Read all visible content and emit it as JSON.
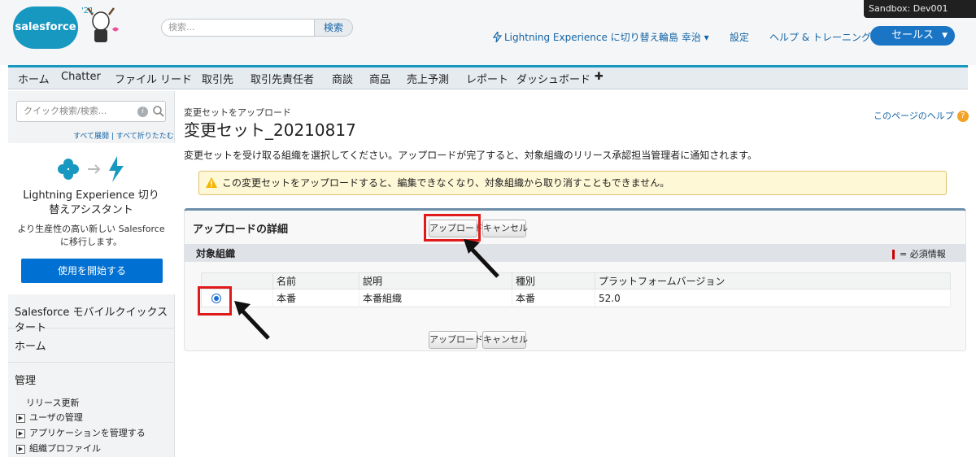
{
  "header": {
    "logo_text": "salesforce",
    "year_badge": "'21",
    "search_placeholder": "検索...",
    "search_button": "検索",
    "sandbox_label": "Sandbox:  Dev001",
    "lightning_switch": "Lightning Experience に切り替え",
    "user_name": "輪島 幸治 ▾",
    "setup": "設定",
    "help_training": "ヘルプ & トレーニング",
    "app_menu": "セールス",
    "app_menu_caret": "▼"
  },
  "tabs": [
    "ホーム",
    "Chatter",
    "ファイル",
    "リード",
    "取引先",
    "取引先責任者",
    "商談",
    "商品",
    "売上予測",
    "レポート",
    "ダッシュボード",
    "✚"
  ],
  "sidebar": {
    "quick_find_placeholder": "クイック検索/検索...",
    "quick_find_info": "i",
    "expand_links": "すべて展開 | すべて折りたたむ",
    "assistant_title": "Lightning Experience 切り替えアシスタント",
    "assistant_desc": "より生産性の高い新しい Salesforce に移行します。",
    "start_button": "使用を開始する",
    "mobile_quickstart": "Salesforce モバイルクイックスタート",
    "home": "ホーム",
    "admin": "管理",
    "admin_items": {
      "release_update": "リリース更新",
      "user_mgmt": "ユーザの管理",
      "app_mgmt": "アプリケーションを管理する",
      "org_profile": "組織プロファイル"
    },
    "tree_toggle": "▶"
  },
  "main": {
    "breadcrumb": "変更セットをアップロード",
    "title": "変更セット_20210817",
    "help_link": "このページのヘルプ",
    "help_icon": "?",
    "instruction": "変更セットを受け取る組織を選択してください。アップロードが完了すると、対象組織のリリース承認担当管理者に通知されます。",
    "warning": "この変更セットをアップロードすると、編集できなくなり、対象組織から取り消すこともできません。",
    "detail_title": "アップロードの詳細",
    "upload_button": "アップロード",
    "cancel_button": "キャンセル",
    "section_title": "対象組織",
    "required_info": "= 必須情報",
    "table": {
      "headers": [
        "",
        "名前",
        "説明",
        "種別",
        "プラットフォームバージョン"
      ],
      "rows": [
        {
          "selected": true,
          "name": "本番",
          "description": "本番組織",
          "type": "本番",
          "version": "52.0"
        }
      ]
    }
  },
  "colors": {
    "brand": "#1798c1",
    "primary_button": "#0070d2",
    "highlight": "#e01a1a",
    "warning_bg": "#fff8d6"
  }
}
